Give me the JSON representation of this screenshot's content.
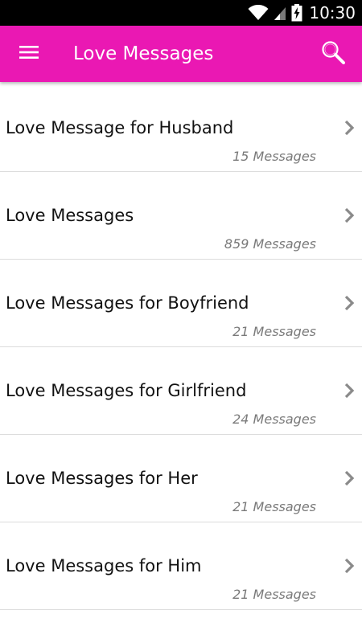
{
  "status_bar": {
    "time": "10:30",
    "icons": [
      "wifi-icon",
      "signal-icon",
      "battery-charging-icon"
    ]
  },
  "app_bar": {
    "title": "Love Messages",
    "menu_icon": "hamburger-menu-icon",
    "search_icon": "search-icon",
    "color": "#ea18b3"
  },
  "categories": [
    {
      "title": "Love Message for Husband",
      "count": "15 Messages"
    },
    {
      "title": "Love Messages",
      "count": "859 Messages"
    },
    {
      "title": "Love Messages for Boyfriend",
      "count": "21 Messages"
    },
    {
      "title": "Love Messages for Girlfriend",
      "count": "24 Messages"
    },
    {
      "title": "Love Messages for Her",
      "count": "21 Messages"
    },
    {
      "title": "Love Messages for Him",
      "count": "21 Messages"
    }
  ]
}
